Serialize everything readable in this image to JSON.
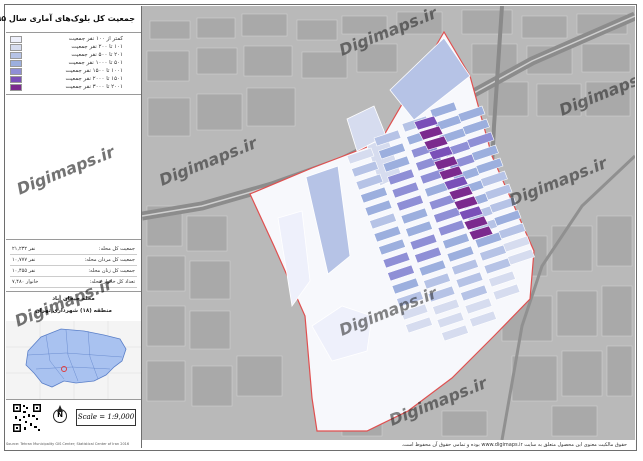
{
  "title": "جمعیت کل بلوک‌های آماری سال ۱۳۹۵",
  "legend": [
    {
      "label": "کمتر از ۱۰۰ نفر جمعیت",
      "color": "#eef0fb"
    },
    {
      "label": "۱۰۱ تا ۲۰۰ نفر جمعیت",
      "color": "#d6dcef"
    },
    {
      "label": "۲۰۱ تا ۵۰۰ نفر جمعیت",
      "color": "#b6c3e6"
    },
    {
      "label": "۵۰۱ تا ۱۰۰۰ نفر جمعیت",
      "color": "#9cafde"
    },
    {
      "label": "۱۰۰۱ تا ۱۵۰۰ نفر جمعیت",
      "color": "#8f8fd6"
    },
    {
      "label": "۱۵۰۱ تا ۲۰۰۰ نفر جمعیت",
      "color": "#7a4fb8"
    },
    {
      "label": "۲۰۰۱ تا ۳۰۰۰ نفر جمعیت",
      "color": "#7b2a8e"
    }
  ],
  "stats": [
    {
      "key": "جمعیت کل محله:",
      "value": "۲۱,۲۳۲ نفر"
    },
    {
      "key": "جمعیت کل مردان محله:",
      "value": "۱۰,۷۷۷ نفر"
    },
    {
      "key": "جمعیت کل زنان محله:",
      "value": "۱۰,۴۵۵ نفر"
    },
    {
      "key": "تعداد کل خانوار محله:",
      "value": "۷,۴۸۰ خانوار"
    }
  ],
  "neighborhood": "محله جیحان آباد",
  "district": "منطقه (۱۸) شهرداری تهران",
  "scale": "Scale = 1:9,000",
  "north": "N",
  "watermark": "Digimaps.ir",
  "disclaimer": "حقوق مالکیت معنوی این محصول متعلق به سایت www.digimaps.ir بوده و تمامی حقوق آن محفوظ است.",
  "provenance": "Source: Tehran Municipality GIS Center; Statistical Center of Iran 2016"
}
